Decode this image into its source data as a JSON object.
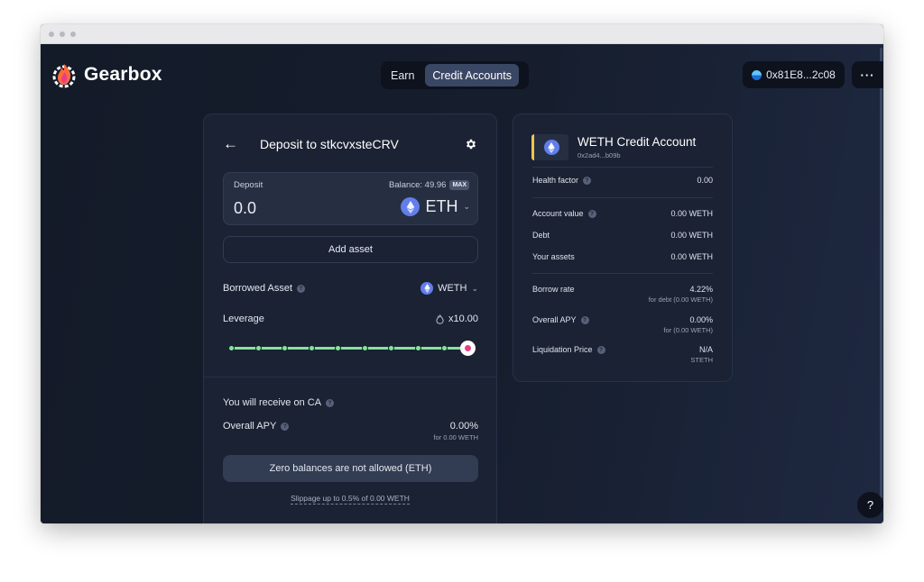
{
  "header": {
    "brand": "Gearbox",
    "nav_tabs": [
      {
        "label": "Earn",
        "active": false
      },
      {
        "label": "Credit Accounts",
        "active": true
      }
    ],
    "wallet_address": "0x81E8...2c08",
    "more_label": "···"
  },
  "deposit_card": {
    "title": "Deposit to stkcvxsteCRV",
    "deposit_label": "Deposit",
    "balance_label": "Balance: 49.96",
    "max_label": "MAX",
    "amount": "0.0",
    "asset": "ETH",
    "add_asset_label": "Add asset",
    "borrowed_asset_label": "Borrowed Asset",
    "borrowed_asset": "WETH",
    "leverage_label": "Leverage",
    "leverage_value": "x10.00",
    "leverage_level": 1.0,
    "receive_label": "You will receive on CA",
    "overall_apy_label": "Overall APY",
    "overall_apy_value": "0.00%",
    "overall_apy_sub": "for 0.00 WETH",
    "submit_label": "Zero balances are not allowed (ETH)",
    "slippage_text": "Slippage up to 0.5% of 0.00 WETH"
  },
  "credit_card": {
    "title": "WETH Credit Account",
    "address": "0x2ad4...b09b",
    "health_factor_label": "Health factor",
    "health_factor_value": "0.00",
    "account_value_label": "Account value",
    "account_value": "0.00 WETH",
    "debt_label": "Debt",
    "debt_value": "0.00 WETH",
    "assets_label": "Your assets",
    "assets_value": "0.00 WETH",
    "borrow_rate_label": "Borrow rate",
    "borrow_rate_value": "4.22%",
    "borrow_rate_sub": "for debt (0.00 WETH)",
    "overall_apy_label": "Overall APY",
    "overall_apy_value": "0.00%",
    "overall_apy_sub": "for (0.00 WETH)",
    "liq_price_label": "Liquidation Price",
    "liq_price_value": "N/A",
    "liq_price_sub": "STETH"
  },
  "help_label": "?",
  "colors": {
    "background": "#151c2b",
    "card": "#1a2233",
    "slider": "#86e39c",
    "thumb_dot": "#e63f86",
    "eth": "#627eea",
    "accent_tab": "#3a4764"
  },
  "icons": {
    "back": "arrow-left-icon",
    "settings": "gear-icon",
    "eth": "ethereum-icon",
    "info": "info-icon",
    "fire": "fire-icon",
    "chevron": "chevron-down-icon"
  }
}
